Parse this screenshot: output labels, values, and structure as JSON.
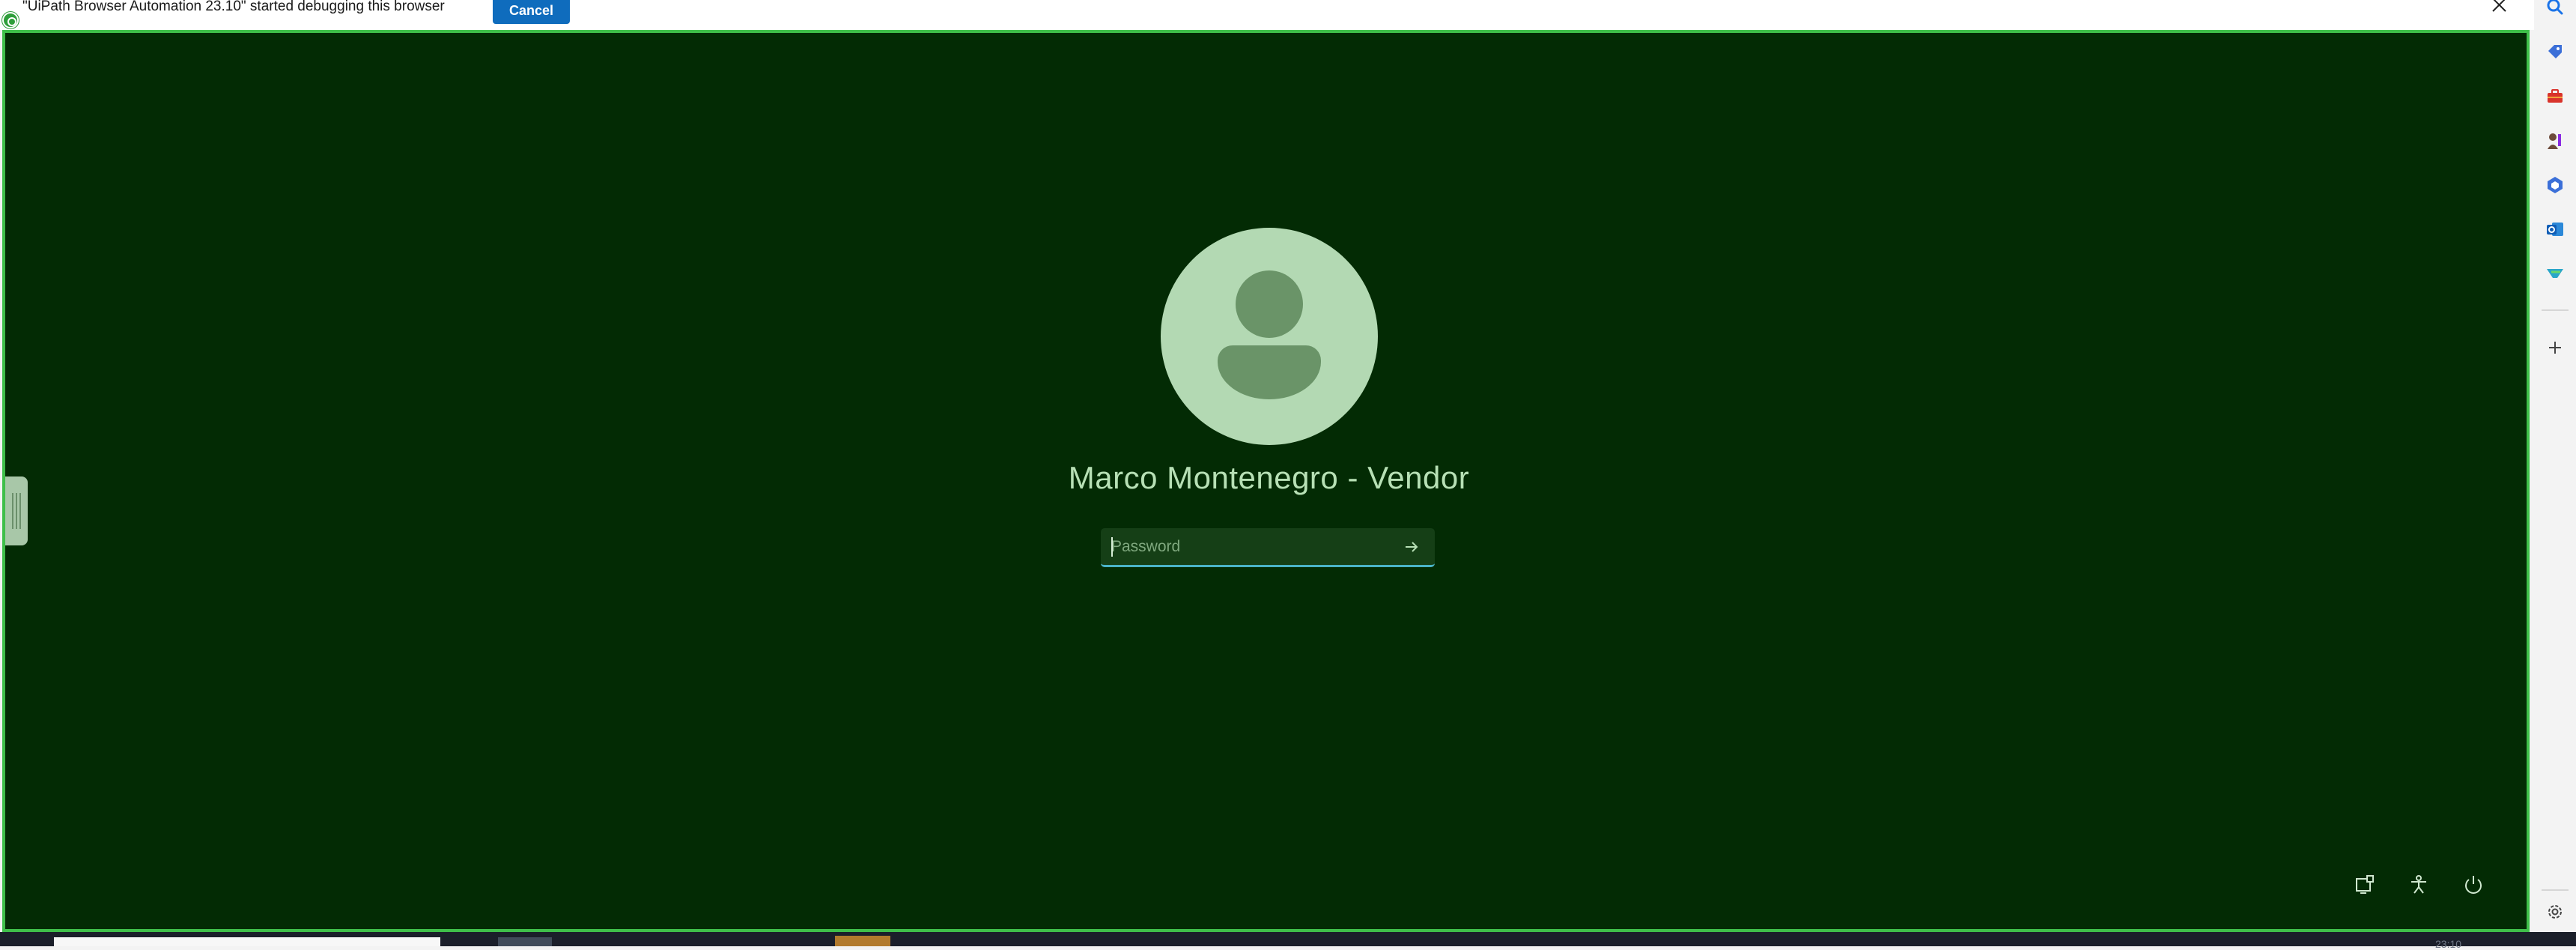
{
  "infobar": {
    "message": "\"UiPath Browser Automation 23.10\" started debugging this browser",
    "cancel_label": "Cancel"
  },
  "sidebar": {
    "items": [
      {
        "name": "search-icon"
      },
      {
        "name": "shopping-tag-icon"
      },
      {
        "name": "tools-icon"
      },
      {
        "name": "games-icon"
      },
      {
        "name": "microsoft-365-icon"
      },
      {
        "name": "outlook-icon"
      },
      {
        "name": "drop-icon"
      },
      {
        "name": "add-icon"
      },
      {
        "name": "settings-icon"
      }
    ]
  },
  "lock_screen": {
    "username": "Marco Montenegro - Vendor",
    "password_placeholder": "Password",
    "actions": [
      {
        "name": "network-icon"
      },
      {
        "name": "accessibility-icon"
      },
      {
        "name": "power-icon"
      }
    ],
    "colors": {
      "background": "#032b04",
      "accent": "#3fbf4a",
      "text": "#b7e0b5"
    }
  },
  "taskbar": {
    "clock": "23:10"
  }
}
